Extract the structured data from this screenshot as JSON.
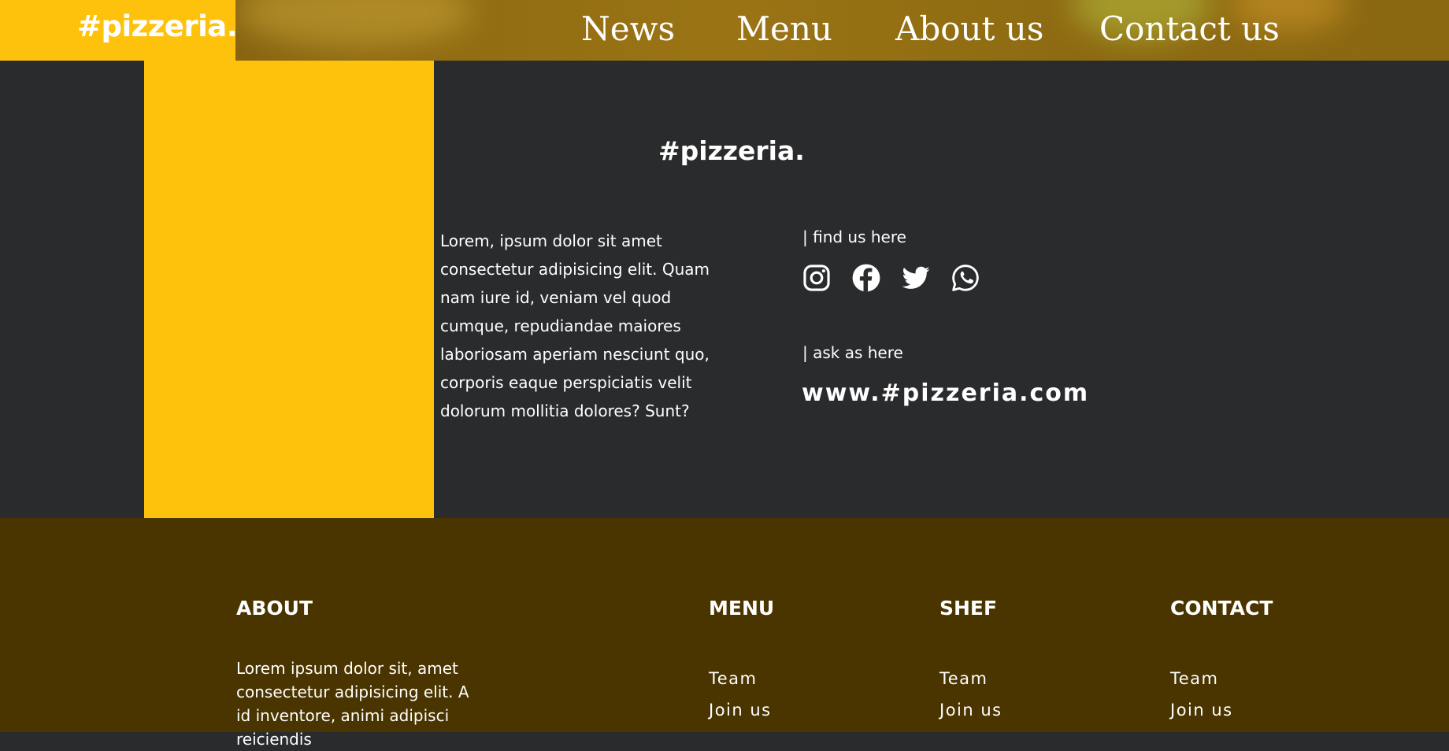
{
  "header": {
    "brand": "#pizzeria.",
    "nav": [
      "News",
      "Menu",
      "About us",
      "Contact us"
    ]
  },
  "main": {
    "brand": "#pizzeria.",
    "description": "Lorem, ipsum dolor sit amet consectetur adipisicing elit. Quam nam iure id, veniam vel quod cumque, repudiandae maiores laboriosam aperiam nesciunt quo, corporis eaque perspiciatis velit dolorum mollitia dolores? Sunt?",
    "find_label": "| find us here",
    "ask_label": "| ask as here",
    "url": "www.#pizzeria.com",
    "socials": [
      "instagram-icon",
      "facebook-icon",
      "twitter-icon",
      "whatsapp-icon"
    ]
  },
  "footer": {
    "about": {
      "heading": "ABOUT",
      "text": "Lorem ipsum dolor sit, amet consectetur adipisicing elit. A id inventore, animi adipisci reiciendis"
    },
    "columns": [
      {
        "heading": "MENU",
        "links": [
          "Team",
          "Join us"
        ]
      },
      {
        "heading": "SHEF",
        "links": [
          "Team",
          "Join us"
        ]
      },
      {
        "heading": "CONTACT",
        "links": [
          "Team",
          "Join us"
        ]
      }
    ]
  },
  "colors": {
    "accent_yellow": "#fec20c",
    "dark_bg": "#2a2b2d",
    "footer_bg": "#4a3500",
    "header_bg": "#8e6a12"
  }
}
